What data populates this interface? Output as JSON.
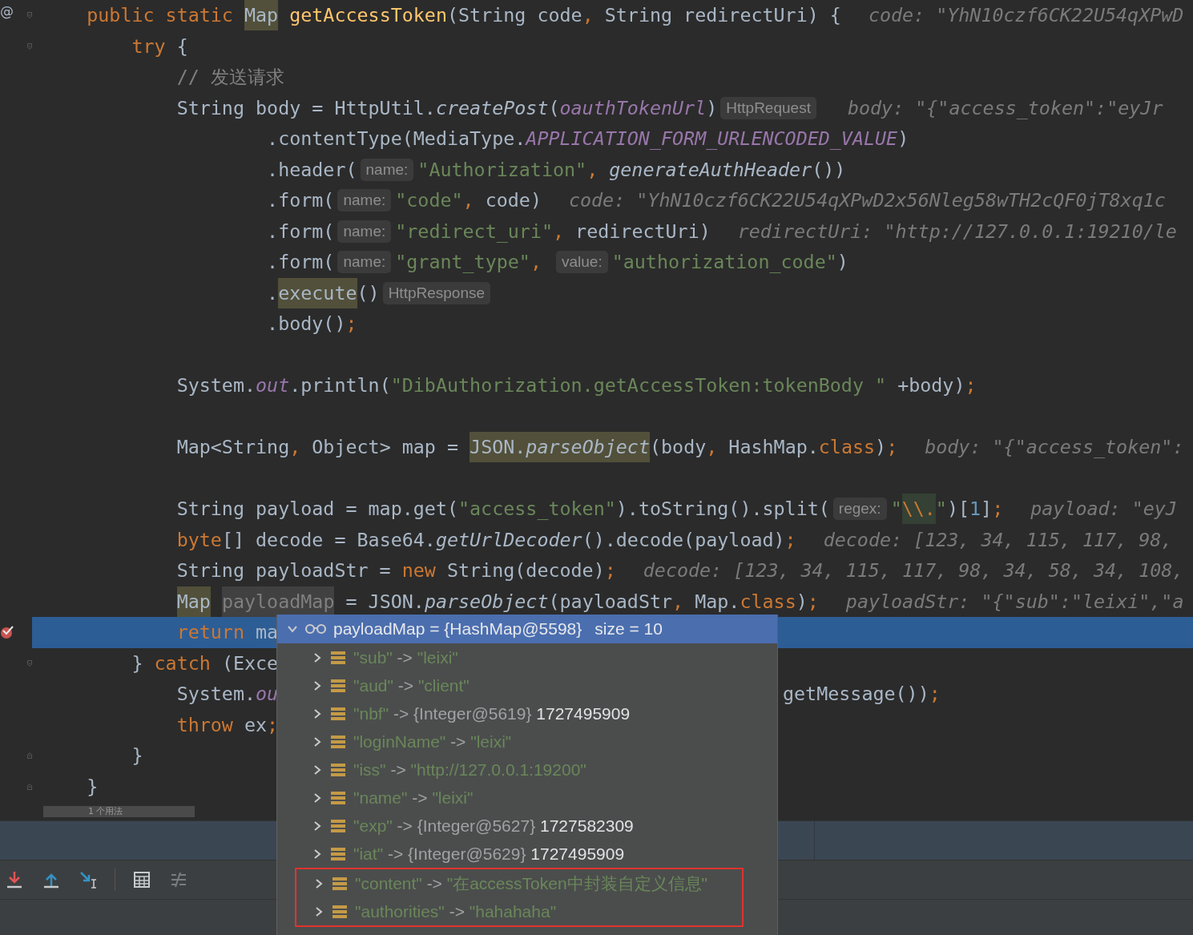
{
  "editor": {
    "lines": [
      {
        "current": false,
        "breakpoint": false,
        "gutter_mark": "@",
        "fold_start": true,
        "segments": [
          {
            "kind": "code",
            "tokens": [
              {
                "kind": "kw",
                "s": "    public static "
              },
              {
                "kind": "p",
                "s": "Map",
                "highlighted": true
              },
              {
                "kind": "fn",
                "s": " getAccessToken"
              },
              {
                "kind": "p",
                "s": "(String code"
              },
              {
                "kind": "kw",
                "s": ", "
              },
              {
                "kind": "p",
                "s": "String redirectUri) {"
              }
            ]
          },
          {
            "kind": "debug",
            "text": "code: \"YhN10czf6CK22U54qXPwD"
          }
        ]
      },
      {
        "current": false,
        "breakpoint": false,
        "fold_start": true,
        "segments": [
          {
            "kind": "code",
            "tokens": [
              {
                "kind": "kw",
                "s": "        try "
              },
              {
                "kind": "p",
                "s": "{"
              }
            ]
          }
        ]
      },
      {
        "current": false,
        "breakpoint": false,
        "segments": [
          {
            "kind": "code",
            "tokens": [
              {
                "kind": "cm",
                "s": "            // 发送请求"
              }
            ]
          }
        ]
      },
      {
        "current": false,
        "breakpoint": false,
        "segments": [
          {
            "kind": "code",
            "tokens": [
              {
                "kind": "p",
                "s": "            String body = HttpUtil."
              },
              {
                "kind": "it",
                "s": "createPost"
              },
              {
                "kind": "p",
                "s": "("
              },
              {
                "kind": "fld",
                "s": "oauthTokenUrl"
              },
              {
                "kind": "p",
                "s": ")"
              }
            ]
          },
          {
            "kind": "hint",
            "text": "HttpRequest"
          },
          {
            "kind": "debug",
            "text": "body: \"{\"access_token\":\"eyJr"
          }
        ]
      },
      {
        "current": false,
        "breakpoint": false,
        "segments": [
          {
            "kind": "code",
            "tokens": [
              {
                "kind": "p",
                "s": "                    .contentType(MediaType."
              },
              {
                "kind": "fld",
                "s": "APPLICATION_FORM_URLENCODED_VALUE"
              },
              {
                "kind": "p",
                "s": ")"
              }
            ]
          }
        ]
      },
      {
        "current": false,
        "breakpoint": false,
        "segments": [
          {
            "kind": "code",
            "tokens": [
              {
                "kind": "p",
                "s": "                    .header("
              }
            ]
          },
          {
            "kind": "hint",
            "text": "name:"
          },
          {
            "kind": "code",
            "tokens": [
              {
                "kind": "str",
                "s": "\"Authorization\""
              },
              {
                "kind": "kw",
                "s": ", "
              },
              {
                "kind": "it",
                "s": "generateAuthHeader"
              },
              {
                "kind": "p",
                "s": "())"
              }
            ]
          }
        ]
      },
      {
        "current": false,
        "breakpoint": false,
        "segments": [
          {
            "kind": "code",
            "tokens": [
              {
                "kind": "p",
                "s": "                    .form("
              }
            ]
          },
          {
            "kind": "hint",
            "text": "name:"
          },
          {
            "kind": "code",
            "tokens": [
              {
                "kind": "str",
                "s": "\"code\""
              },
              {
                "kind": "kw",
                "s": ", "
              },
              {
                "kind": "p",
                "s": "code)"
              }
            ]
          },
          {
            "kind": "debug",
            "text": "code: \"YhN10czf6CK22U54qXPwD2x56Nleg58wTH2cQF0jT8xq1c"
          }
        ]
      },
      {
        "current": false,
        "breakpoint": false,
        "segments": [
          {
            "kind": "code",
            "tokens": [
              {
                "kind": "p",
                "s": "                    .form("
              }
            ]
          },
          {
            "kind": "hint",
            "text": "name:"
          },
          {
            "kind": "code",
            "tokens": [
              {
                "kind": "str",
                "s": "\"redirect_uri\""
              },
              {
                "kind": "kw",
                "s": ", "
              },
              {
                "kind": "p",
                "s": "redirectUri)"
              }
            ]
          },
          {
            "kind": "debug",
            "text": "redirectUri: \"http://127.0.0.1:19210/le"
          }
        ]
      },
      {
        "current": false,
        "breakpoint": false,
        "segments": [
          {
            "kind": "code",
            "tokens": [
              {
                "kind": "p",
                "s": "                    .form("
              }
            ]
          },
          {
            "kind": "hint",
            "text": "name:"
          },
          {
            "kind": "code",
            "tokens": [
              {
                "kind": "str",
                "s": "\"grant_type\""
              },
              {
                "kind": "kw",
                "s": ", "
              }
            ]
          },
          {
            "kind": "hint",
            "text": "value:"
          },
          {
            "kind": "code",
            "tokens": [
              {
                "kind": "str",
                "s": "\"authorization_code\""
              },
              {
                "kind": "p",
                "s": ")"
              }
            ]
          }
        ]
      },
      {
        "current": false,
        "breakpoint": false,
        "segments": [
          {
            "kind": "code",
            "tokens": [
              {
                "kind": "p",
                "s": "                    ."
              },
              {
                "kind": "p",
                "s": "execute",
                "highlighted": true
              },
              {
                "kind": "p",
                "s": "()"
              }
            ]
          },
          {
            "kind": "hint",
            "text": "HttpResponse"
          }
        ]
      },
      {
        "current": false,
        "breakpoint": false,
        "segments": [
          {
            "kind": "code",
            "tokens": [
              {
                "kind": "p",
                "s": "                    .body()"
              },
              {
                "kind": "kw",
                "s": ";"
              }
            ]
          }
        ]
      },
      {
        "current": false,
        "breakpoint": false
      },
      {
        "current": false,
        "breakpoint": false,
        "segments": [
          {
            "kind": "code",
            "tokens": [
              {
                "kind": "p",
                "s": "            System."
              },
              {
                "kind": "fld",
                "s": "out"
              },
              {
                "kind": "p",
                "s": ".println("
              },
              {
                "kind": "str",
                "s": "\"DibAuthorization.getAccessToken:tokenBody \""
              },
              {
                "kind": "p",
                "s": " +body)"
              },
              {
                "kind": "kw",
                "s": ";"
              }
            ]
          }
        ]
      },
      {
        "current": false,
        "breakpoint": false
      },
      {
        "current": false,
        "breakpoint": false,
        "segments": [
          {
            "kind": "code",
            "tokens": [
              {
                "kind": "p",
                "s": "            Map<String"
              },
              {
                "kind": "kw",
                "s": ", "
              },
              {
                "kind": "p",
                "s": "Object> map = "
              },
              {
                "kind": "p",
                "s": "JSON.",
                "highlighted": true
              },
              {
                "kind": "it",
                "s": "parseObject",
                "highlighted": true
              },
              {
                "kind": "p",
                "s": "(body"
              },
              {
                "kind": "kw",
                "s": ", "
              },
              {
                "kind": "p",
                "s": "HashMap."
              },
              {
                "kind": "kw",
                "s": "class"
              },
              {
                "kind": "p",
                "s": ")"
              },
              {
                "kind": "kw",
                "s": ";"
              }
            ]
          },
          {
            "kind": "debug",
            "text": "body: \"{\"access_token\":"
          }
        ]
      },
      {
        "current": false,
        "breakpoint": false
      },
      {
        "current": false,
        "breakpoint": false,
        "segments": [
          {
            "kind": "code",
            "tokens": [
              {
                "kind": "p",
                "s": "            String payload = map.get("
              },
              {
                "kind": "str",
                "s": "\"access_token\""
              },
              {
                "kind": "p",
                "s": ").toString().split("
              }
            ]
          },
          {
            "kind": "hint",
            "text": "regex:"
          },
          {
            "kind": "code",
            "tokens": [
              {
                "kind": "str",
                "s": "\""
              },
              {
                "kind": "kw",
                "s": "\\\\.",
                "highlighted": true
              },
              {
                "kind": "str",
                "s": "\""
              },
              {
                "kind": "p",
                "s": ")["
              },
              {
                "kind": "num",
                "s": "1"
              },
              {
                "kind": "p",
                "s": "]"
              },
              {
                "kind": "kw",
                "s": ";"
              }
            ]
          },
          {
            "kind": "debug",
            "text": "payload: \"eyJ"
          }
        ]
      },
      {
        "current": false,
        "breakpoint": false,
        "segments": [
          {
            "kind": "code",
            "tokens": [
              {
                "kind": "kw",
                "s": "            byte"
              },
              {
                "kind": "p",
                "s": "[] decode = Base64."
              },
              {
                "kind": "it",
                "s": "getUrlDecoder"
              },
              {
                "kind": "p",
                "s": "().decode(payload)"
              },
              {
                "kind": "kw",
                "s": ";"
              }
            ]
          },
          {
            "kind": "debug",
            "text": "decode: [123, 34, 115, 117, 98,"
          }
        ]
      },
      {
        "current": false,
        "breakpoint": false,
        "segments": [
          {
            "kind": "code",
            "tokens": [
              {
                "kind": "p",
                "s": "            String payloadStr = "
              },
              {
                "kind": "kw",
                "s": "new "
              },
              {
                "kind": "p",
                "s": "String(decode)"
              },
              {
                "kind": "kw",
                "s": ";"
              }
            ]
          },
          {
            "kind": "debug",
            "text": "decode: [123, 34, 115, 117, 98, 34, 58, 34, 108,"
          }
        ]
      },
      {
        "current": false,
        "breakpoint": false,
        "segments": [
          {
            "kind": "code",
            "tokens": [
              {
                "kind": "p",
                "s": "            Map",
                "highlighted": true
              },
              {
                "kind": "unused",
                "s": " payloadMap",
                "highlighted": true
              },
              {
                "kind": "p",
                "s": " = JSON."
              },
              {
                "kind": "it",
                "s": "parseObject"
              },
              {
                "kind": "p",
                "s": "(payloadStr"
              },
              {
                "kind": "kw",
                "s": ", "
              },
              {
                "kind": "p",
                "s": "Map."
              },
              {
                "kind": "kw",
                "s": "class"
              },
              {
                "kind": "p",
                "s": ")"
              },
              {
                "kind": "kw",
                "s": ";"
              }
            ]
          },
          {
            "kind": "debug",
            "text": "payloadStr: \"{\"sub\":\"leixi\",\"a"
          }
        ]
      },
      {
        "current": true,
        "breakpoint": true,
        "segments": [
          {
            "kind": "code",
            "tokens": [
              {
                "kind": "kw",
                "s": "            return "
              },
              {
                "kind": "p",
                "s": "ma"
              }
            ]
          }
        ]
      },
      {
        "current": false,
        "breakpoint": false,
        "fold_start": true,
        "segments": [
          {
            "kind": "code",
            "tokens": [
              {
                "kind": "p",
                "s": "        } "
              },
              {
                "kind": "kw",
                "s": "catch "
              },
              {
                "kind": "p",
                "s": "(Exce"
              }
            ]
          }
        ]
      },
      {
        "current": false,
        "breakpoint": false,
        "segments": [
          {
            "kind": "code",
            "tokens": [
              {
                "kind": "p",
                "s": "            System."
              },
              {
                "kind": "fld",
                "s": "ou"
              }
            ]
          }
        ],
        "after_popup": [
          {
            "kind": "code",
            "tokens": [
              {
                "kind": "p",
                "s": "getMessage())"
              },
              {
                "kind": "kw",
                "s": ";"
              }
            ]
          }
        ]
      },
      {
        "current": false,
        "breakpoint": false,
        "segments": [
          {
            "kind": "code",
            "tokens": [
              {
                "kind": "kw",
                "s": "            throw "
              },
              {
                "kind": "p",
                "s": "ex"
              },
              {
                "kind": "kw",
                "s": ";"
              }
            ]
          }
        ]
      },
      {
        "current": false,
        "breakpoint": false,
        "fold_end": true,
        "segments": [
          {
            "kind": "code",
            "tokens": [
              {
                "kind": "p",
                "s": "        }"
              }
            ]
          }
        ]
      },
      {
        "current": false,
        "breakpoint": false,
        "fold_end": true,
        "segments": [
          {
            "kind": "code",
            "tokens": [
              {
                "kind": "p",
                "s": "    }"
              }
            ]
          }
        ]
      }
    ],
    "usage_hint": "1 个用法"
  },
  "debug_popup": {
    "label": "payloadMap = {HashMap@5598}",
    "size": "size = 10",
    "entries": [
      {
        "key": "\"sub\"",
        "arrow": "->",
        "value": "\"leixi\"",
        "marked": false
      },
      {
        "key": "\"aud\"",
        "arrow": "->",
        "value": "\"client\"",
        "marked": false
      },
      {
        "key": "\"nbf\"",
        "arrow": "->",
        "ref": "{Integer@5619}",
        "value": "1727495909",
        "marked": false
      },
      {
        "key": "\"loginName\"",
        "arrow": "->",
        "value": "\"leixi\"",
        "marked": false
      },
      {
        "key": "\"iss\"",
        "arrow": "->",
        "value": "\"http://127.0.0.1:19200\"",
        "marked": false
      },
      {
        "key": "\"name\"",
        "arrow": "->",
        "value": "\"leixi\"",
        "marked": false
      },
      {
        "key": "\"exp\"",
        "arrow": "->",
        "ref": "{Integer@5627}",
        "value": "1727582309",
        "marked": false
      },
      {
        "key": "\"iat\"",
        "arrow": "->",
        "ref": "{Integer@5629}",
        "value": "1727495909",
        "marked": false
      },
      {
        "key": "\"content\"",
        "arrow": "->",
        "value": "\"在accessToken中封装自定义信息\"",
        "marked": true
      },
      {
        "key": "\"authorities\"",
        "arrow": "->",
        "value": "\"hahahaha\"",
        "marked": true
      }
    ]
  }
}
